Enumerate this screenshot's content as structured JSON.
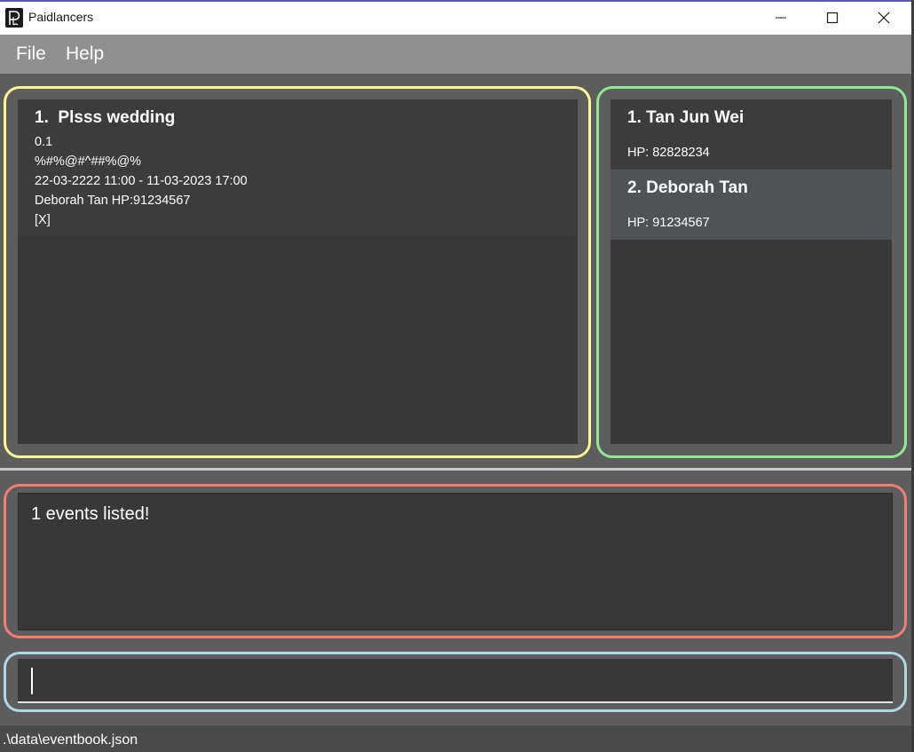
{
  "window": {
    "title": "Paidlancers"
  },
  "menu": {
    "file": "File",
    "help": "Help"
  },
  "events": [
    {
      "index": "1.",
      "name": "Plsss wedding",
      "rate": "0.1",
      "address": "%#%@#^##%@%",
      "timing": "22-03-2222 11:00 - 11-03-2023 17:00",
      "contact": "Deborah Tan HP:91234567",
      "mark": "[X]"
    }
  ],
  "contacts": [
    {
      "title": "1. Tan Jun Wei",
      "phone": "HP: 82828234"
    },
    {
      "title": "2. Deborah Tan",
      "phone": "HP: 91234567"
    }
  ],
  "result": {
    "message": "1 events listed!"
  },
  "command": {
    "value": ""
  },
  "status": {
    "path": ".\\data\\eventbook.json"
  },
  "colors": {
    "event_outline": "#fef597",
    "contact_outline": "#90e890",
    "result_outline": "#f17e6f",
    "command_outline": "#add8e6",
    "selected_contact": "#4e5356"
  }
}
